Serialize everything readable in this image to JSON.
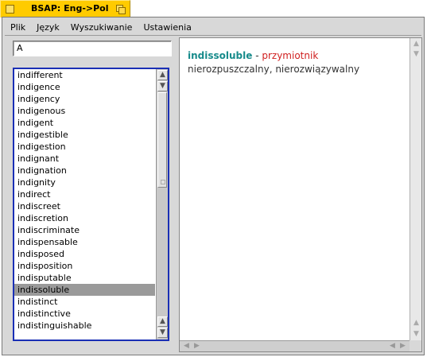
{
  "window": {
    "title": "BSAP: Eng->Pol"
  },
  "menu": {
    "items": [
      "Plik",
      "Język",
      "Wyszukiwanie",
      "Ustawienia"
    ]
  },
  "search": {
    "value": "A"
  },
  "word_list": {
    "items": [
      "indifferent",
      "indigence",
      "indigency",
      "indigenous",
      "indigent",
      "indigestible",
      "indigestion",
      "indignant",
      "indignation",
      "indignity",
      "indirect",
      "indiscreet",
      "indiscretion",
      "indiscriminate",
      "indispensable",
      "indisposed",
      "indisposition",
      "indisputable",
      "indissoluble",
      "indistinct",
      "indistinctive",
      "indistinguishable"
    ],
    "selected": "indissoluble"
  },
  "definition": {
    "headword": "indissoluble",
    "separator": " - ",
    "part_of_speech": "przymiotnik",
    "translation": " nierozpuszczalny, nierozwiązywalny"
  },
  "colors": {
    "tab": "#ffcb00",
    "list_border": "#1a2fb5",
    "headword": "#178b8b",
    "part_of_speech": "#d02020",
    "selection": "#9a9a9a"
  },
  "icons": {
    "close": "close-icon",
    "zoom": "zoom-icon",
    "up": "▲",
    "down": "▼",
    "left": "◀",
    "right": "▶"
  }
}
